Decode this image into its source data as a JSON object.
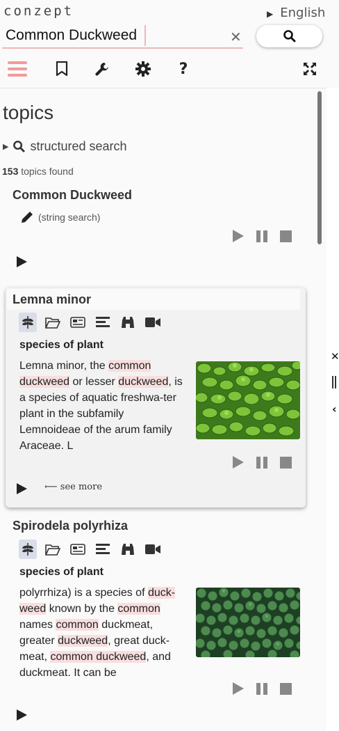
{
  "app": {
    "logo": "conzept",
    "language": "English"
  },
  "search": {
    "value": "Common Duckweed"
  },
  "toolbar": {
    "icons": [
      "menu-icon",
      "bookmark-icon",
      "wrench-icon",
      "gear-icon",
      "help-icon",
      "fullscreen-icon"
    ],
    "accent": "#f29a9a"
  },
  "topics": {
    "heading": "topics",
    "structured_search": "structured search",
    "count": "153",
    "count_suffix": "topics found"
  },
  "string_search_item": {
    "title": "Common Duckweed",
    "label": "(string search)"
  },
  "results": [
    {
      "title": "Lemna minor",
      "type": "species of plant",
      "see_more": "see more",
      "desc_parts": [
        "Lemna minor, the ",
        "common",
        " ",
        "duckweed",
        " or lesser ",
        "duckweed",
        ", is a species of aquatic freshwa-ter plant in the subfamily Lemnoideae of the arum family Araceae. L"
      ]
    },
    {
      "title": "Spirodela polyrhiza",
      "type": "species of plant",
      "desc_parts": [
        "polyrrhiza) is a species of ",
        "duck-weed",
        " known by the ",
        "common",
        " names ",
        "common",
        " duckmeat, greater ",
        "duckweed",
        ", great duck-meat, ",
        "common duckweed",
        ", and duckmeat. It can be"
      ]
    }
  ],
  "colors": {
    "highlight": "#f8dede",
    "icon": "#333333",
    "active_icon_bg": "#d8dde8"
  }
}
